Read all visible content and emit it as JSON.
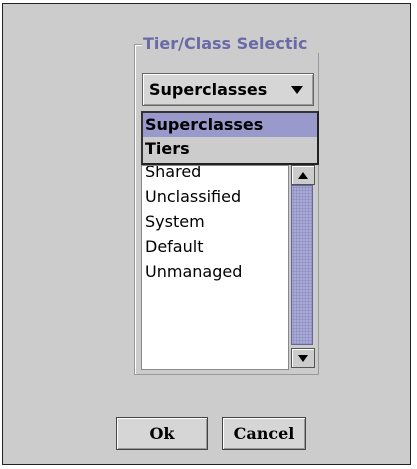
{
  "group": {
    "title": "Tier/Class Selectic"
  },
  "combo": {
    "value": "Superclasses"
  },
  "dropdown": {
    "items": [
      "Superclasses",
      "Tiers"
    ],
    "selected_index": 0
  },
  "list": {
    "items": [
      "Shared",
      "Unclassified",
      "System",
      "Default",
      "Unmanaged"
    ]
  },
  "buttons": {
    "ok_label": "Ok",
    "cancel_label": "Cancel"
  },
  "colors": {
    "dialog_bg": "#cccccc",
    "selection": "#9999cc",
    "title_text": "#6a6aa6",
    "scroll_thumb": "#a9a9d6"
  }
}
